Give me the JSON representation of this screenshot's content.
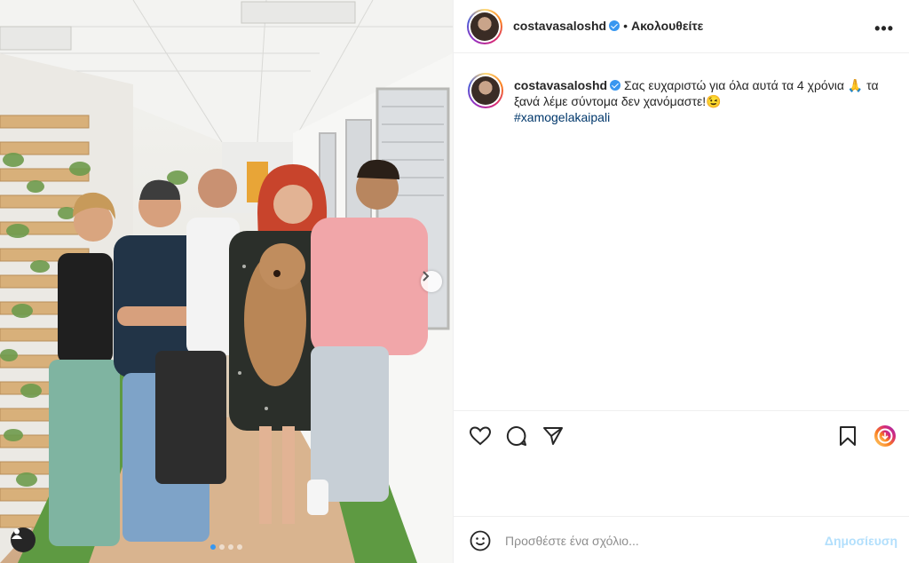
{
  "post": {
    "username": "costavasaloshd",
    "verified": true,
    "separator": "•",
    "follow_status": "Ακολουθείτε",
    "more_icon": "more-horizontal-icon",
    "caption": {
      "line1": "Σας ευχαριστώ για όλα αυτά τα 4 χρόνια 🙏 τα",
      "line2": "ξανά λέμε σύντομα δεν χανόμαστε!😉",
      "hashtag": "#xamogelakaipali"
    },
    "carousel": {
      "slides": 4,
      "current": 1
    },
    "actions": [
      "heart-icon",
      "comment-icon",
      "share-icon",
      "bookmark-icon",
      "story-icon"
    ],
    "comment": {
      "placeholder": "Προσθέστε ένα σχόλιο...",
      "post_label": "Δημοσίευση"
    }
  },
  "colors": {
    "text": "#262626",
    "verified": "#3897f0",
    "hashtag": "#00376b",
    "post_disabled": "#b2dffc",
    "border": "#efefef"
  }
}
